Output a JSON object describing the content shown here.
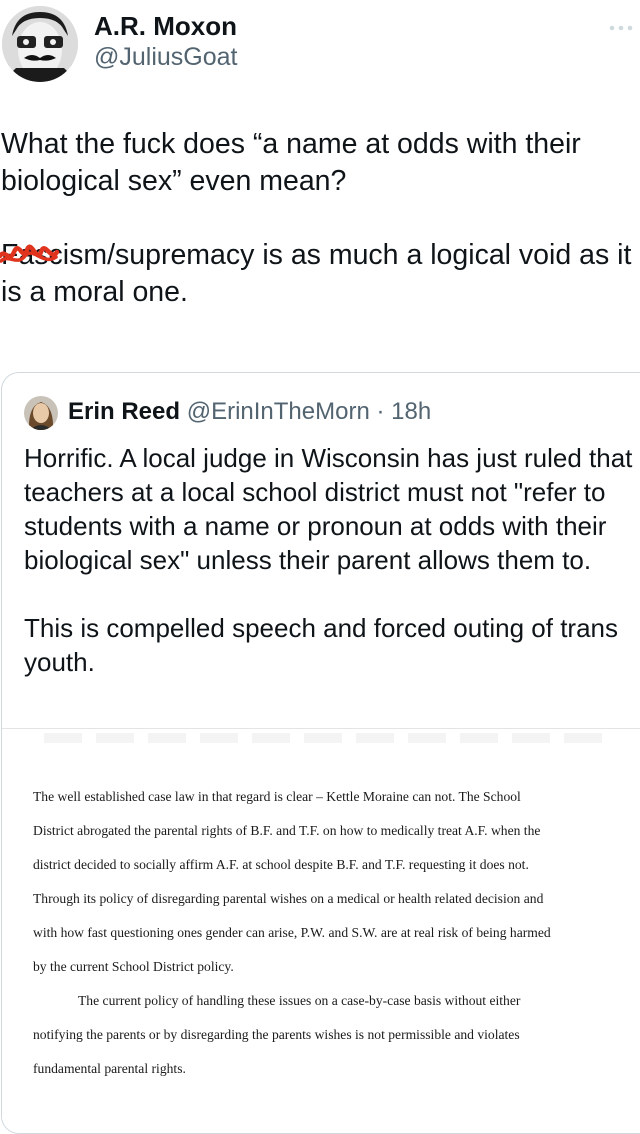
{
  "author": {
    "name": "A.R. Moxon",
    "handle": "@JuliusGoat"
  },
  "tweet": {
    "paragraph1": "What the fuck does “a name at odds with their biological sex” even mean?",
    "struck_word": "Fascism",
    "paragraph2_rest": "/supremacy is as much a logical void as it is a moral one."
  },
  "quote": {
    "name": "Erin Reed",
    "handle": "@ErinInTheMorn",
    "separator": " · ",
    "time": "18h",
    "paragraph1": "Horrific. A local judge in Wisconsin has just ruled that teachers at a local school district must not \"refer to students with a name or pronoun at odds with their biological sex\" unless their parent allows them to.",
    "paragraph2": "This is compelled speech and forced outing of trans youth."
  },
  "document": {
    "lines": [
      "The well established case law in that regard is clear – Kettle Moraine can not.  The School",
      "District abrogated the parental rights of B.F. and T.F. on how to medically treat A.F. when the",
      "district decided to socially affirm A.F. at school despite B.F. and T.F. requesting it does not.",
      "Through its policy of disregarding parental wishes on a medical or health related decision and",
      "with how fast questioning ones gender can arise, P.W. and S.W. are at real risk of being harmed",
      "by the current School District policy.",
      "The current policy of handling these issues on a case-by-case basis without either",
      "notifying the parents or by disregarding the parents wishes is not permissible and violates",
      "fundamental  parental rights."
    ]
  },
  "colors": {
    "text": "#0f1419",
    "secondary": "#536471",
    "border": "#cfd9de",
    "scribble": "#e0341e"
  },
  "icons": {
    "more": "more-options-icon",
    "author_avatar": "profile-avatar",
    "quote_avatar": "quoted-profile-avatar"
  }
}
